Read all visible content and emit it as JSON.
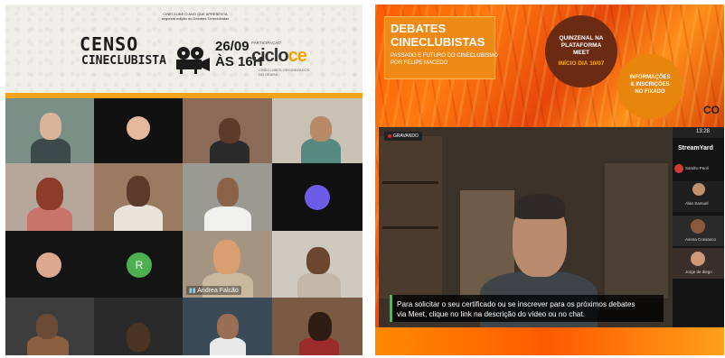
{
  "left_panel": {
    "banner": {
      "title": "CENSO",
      "subtitle": "CINECLUBISTA",
      "presents": "CINECLUBE O ANO QUE APRESENTA",
      "presents_sub": "segunda edição do Debates Cineclubistas",
      "date": "26/09",
      "time": "ÀS 16H",
      "participation_label": "PARTICIPAÇÃO",
      "partner_logo_main": "ciclo",
      "partner_logo_accent": "ce",
      "partner_logo_sub": "CINECLUBES ORGANIZADOS DO CEARÁ"
    },
    "participants": {
      "andrea_label": "Andrea Falcão",
      "r_initial": "R"
    },
    "colors": {
      "accent": "#f2b817",
      "bar": "#f3a21b",
      "avatar_green": "#4caf50"
    }
  },
  "right_panel": {
    "header": {
      "title_line1": "DEBATES",
      "title_line2": "CINECLUBISTAS",
      "subtitle_line1": "PASSADO E FUTURO DO CINECLUBISMO",
      "subtitle_line2": "POR FELIPE MACEDO"
    },
    "badge_schedule": {
      "line1": "QUINZENAL NA",
      "line2": "PLATAFORMA",
      "line3": "MEET",
      "start": "INÍCIO DIA 10/07"
    },
    "badge_info": {
      "line1": "INFORMAÇÕES",
      "line2": "& INSCRIÇÕES",
      "line3": "NO FIXADO"
    },
    "corner_logo": "CO",
    "recording_label": "GRAVANDO",
    "top_time": "13:28",
    "caption_line1": "Para solicitar o seu certificado ou se inscrever para os próximos debates",
    "caption_line2": "via Meet, clique no link na descrição do vídeo ou no chat.",
    "sidebar": {
      "brand": "StreamYard",
      "names": [
        "Sandro Paoli",
        "Alan Samuel",
        "Asena Cossanco",
        "Jorge de diego"
      ]
    },
    "colors": {
      "orange": "#ff6f00",
      "dark_circle": "#6b2a12",
      "yellow_text": "#ffb000",
      "caption_bar": "#2ecc40"
    }
  }
}
